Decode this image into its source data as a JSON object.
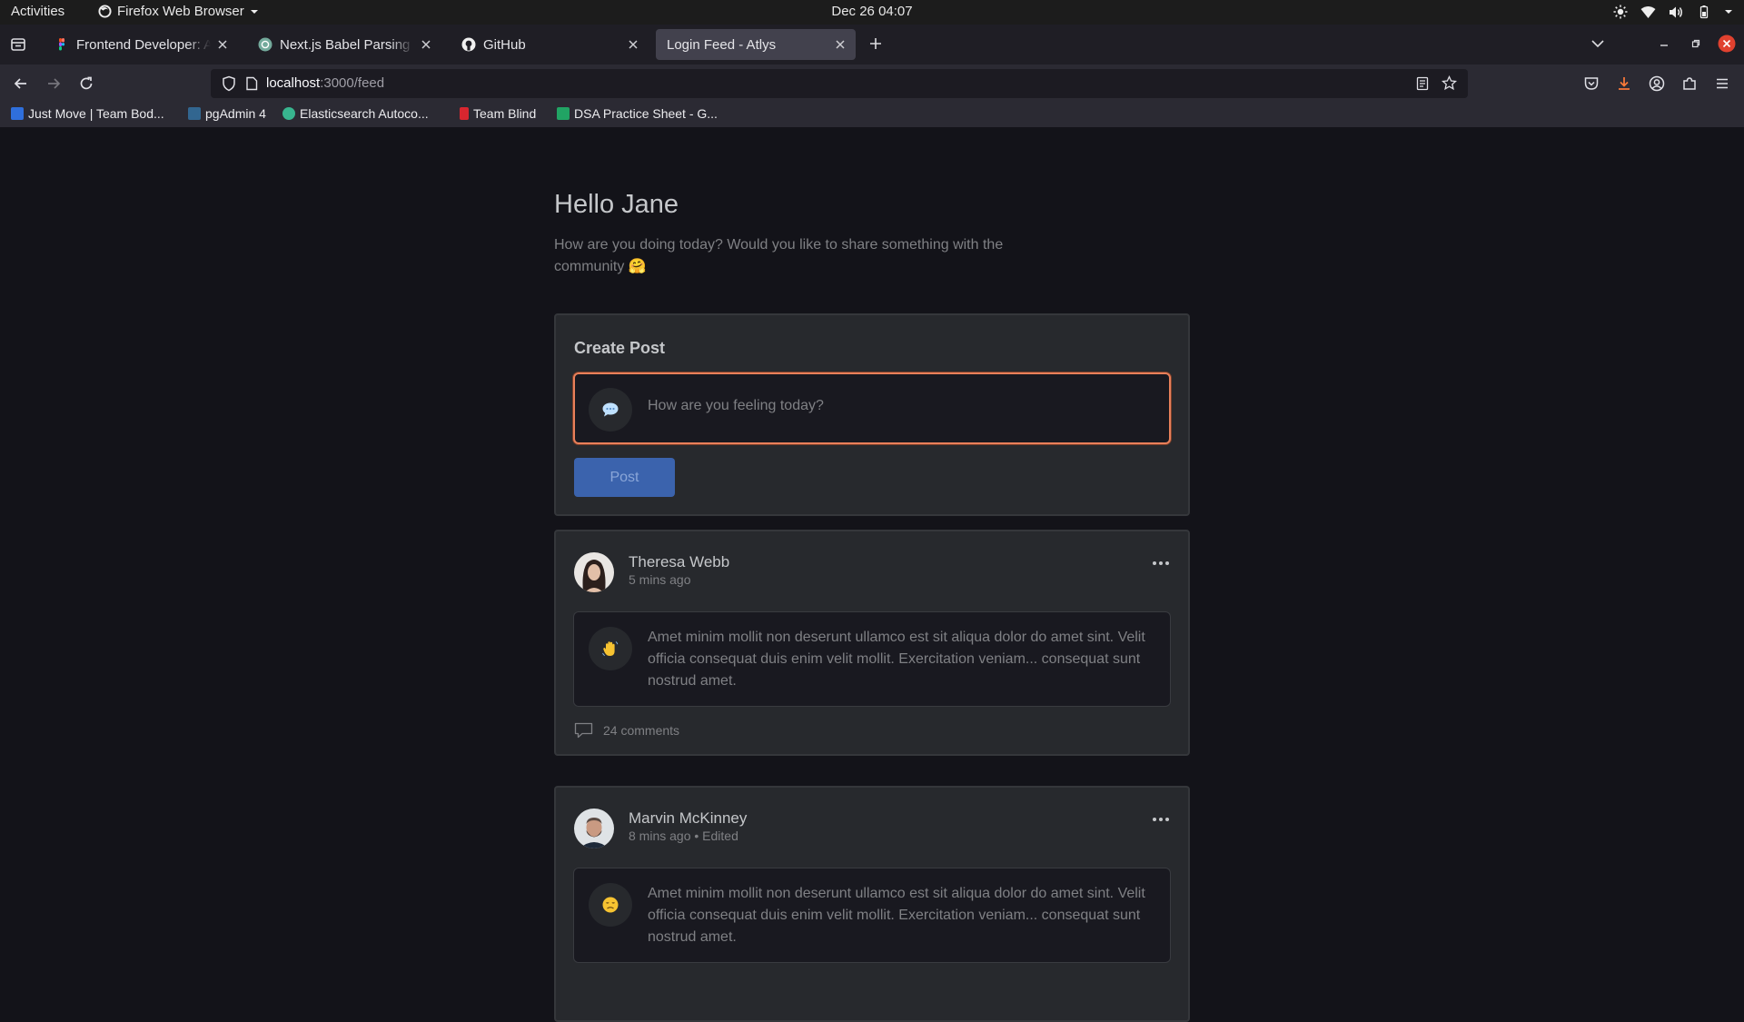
{
  "os_bar": {
    "activities": "Activities",
    "app_name": "Firefox Web Browser",
    "clock": "Dec 26  04:07"
  },
  "tabs": [
    {
      "title": "Frontend Developer: Atlys"
    },
    {
      "title": "Next.js Babel Parsing Error"
    },
    {
      "title": "GitHub"
    },
    {
      "title": "Login Feed - Atlys",
      "active": true
    }
  ],
  "address_bar": {
    "host": "localhost",
    "path": ":3000/feed"
  },
  "bookmarks": [
    {
      "label": "Just Move | Team Bod...",
      "color": "#2f6fdc"
    },
    {
      "label": "pgAdmin 4",
      "color": "#326690"
    },
    {
      "label": "Elasticsearch Autoco...",
      "color": "#38b58f"
    },
    {
      "label": "Team Blind",
      "color": "#d8262f"
    },
    {
      "label": "DSA Practice Sheet - G...",
      "color": "#21a464"
    }
  ],
  "feed": {
    "greeting": "Hello Jane",
    "intro": "How are you doing today? Would you like to share something with the community 🤗",
    "create_post": {
      "title": "Create Post",
      "placeholder": "How are you feeling today?",
      "emoji": "💬",
      "button": "Post"
    },
    "posts": [
      {
        "author": "Theresa Webb",
        "meta": "5 mins ago",
        "emoji": "👋",
        "text": "Amet minim mollit non deserunt ullamco est sit aliqua dolor do amet sint. Velit officia consequat duis enim velit mollit. Exercitation veniam... consequat sunt nostrud amet.",
        "comments": "24 comments"
      },
      {
        "author": "Marvin McKinney",
        "meta": "8 mins ago • Edited",
        "emoji": "😞",
        "text": "Amet minim mollit non deserunt ullamco est sit aliqua dolor do amet sint. Velit officia consequat duis enim velit mollit. Exercitation veniam... consequat sunt nostrud amet."
      }
    ]
  },
  "colors": {
    "accent_button": "#3b63ad",
    "composer_border": "#e9805a",
    "page_background": "#131319",
    "card_background": "#27292d"
  }
}
